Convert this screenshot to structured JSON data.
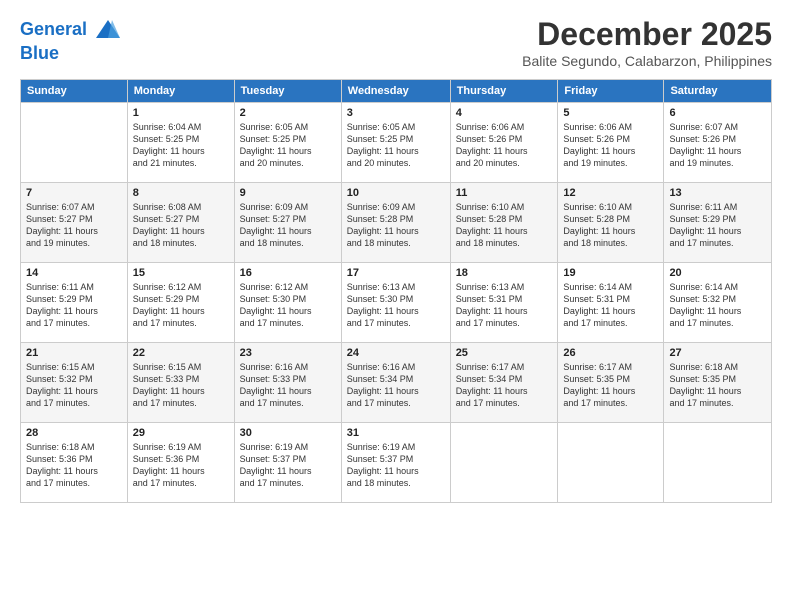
{
  "logo": {
    "line1": "General",
    "line2": "Blue"
  },
  "title": "December 2025",
  "subtitle": "Balite Segundo, Calabarzon, Philippines",
  "header_days": [
    "Sunday",
    "Monday",
    "Tuesday",
    "Wednesday",
    "Thursday",
    "Friday",
    "Saturday"
  ],
  "weeks": [
    [
      {
        "day": "",
        "info": ""
      },
      {
        "day": "1",
        "info": "Sunrise: 6:04 AM\nSunset: 5:25 PM\nDaylight: 11 hours\nand 21 minutes."
      },
      {
        "day": "2",
        "info": "Sunrise: 6:05 AM\nSunset: 5:25 PM\nDaylight: 11 hours\nand 20 minutes."
      },
      {
        "day": "3",
        "info": "Sunrise: 6:05 AM\nSunset: 5:25 PM\nDaylight: 11 hours\nand 20 minutes."
      },
      {
        "day": "4",
        "info": "Sunrise: 6:06 AM\nSunset: 5:26 PM\nDaylight: 11 hours\nand 20 minutes."
      },
      {
        "day": "5",
        "info": "Sunrise: 6:06 AM\nSunset: 5:26 PM\nDaylight: 11 hours\nand 19 minutes."
      },
      {
        "day": "6",
        "info": "Sunrise: 6:07 AM\nSunset: 5:26 PM\nDaylight: 11 hours\nand 19 minutes."
      }
    ],
    [
      {
        "day": "7",
        "info": "Sunrise: 6:07 AM\nSunset: 5:27 PM\nDaylight: 11 hours\nand 19 minutes."
      },
      {
        "day": "8",
        "info": "Sunrise: 6:08 AM\nSunset: 5:27 PM\nDaylight: 11 hours\nand 18 minutes."
      },
      {
        "day": "9",
        "info": "Sunrise: 6:09 AM\nSunset: 5:27 PM\nDaylight: 11 hours\nand 18 minutes."
      },
      {
        "day": "10",
        "info": "Sunrise: 6:09 AM\nSunset: 5:28 PM\nDaylight: 11 hours\nand 18 minutes."
      },
      {
        "day": "11",
        "info": "Sunrise: 6:10 AM\nSunset: 5:28 PM\nDaylight: 11 hours\nand 18 minutes."
      },
      {
        "day": "12",
        "info": "Sunrise: 6:10 AM\nSunset: 5:28 PM\nDaylight: 11 hours\nand 18 minutes."
      },
      {
        "day": "13",
        "info": "Sunrise: 6:11 AM\nSunset: 5:29 PM\nDaylight: 11 hours\nand 17 minutes."
      }
    ],
    [
      {
        "day": "14",
        "info": "Sunrise: 6:11 AM\nSunset: 5:29 PM\nDaylight: 11 hours\nand 17 minutes."
      },
      {
        "day": "15",
        "info": "Sunrise: 6:12 AM\nSunset: 5:29 PM\nDaylight: 11 hours\nand 17 minutes."
      },
      {
        "day": "16",
        "info": "Sunrise: 6:12 AM\nSunset: 5:30 PM\nDaylight: 11 hours\nand 17 minutes."
      },
      {
        "day": "17",
        "info": "Sunrise: 6:13 AM\nSunset: 5:30 PM\nDaylight: 11 hours\nand 17 minutes."
      },
      {
        "day": "18",
        "info": "Sunrise: 6:13 AM\nSunset: 5:31 PM\nDaylight: 11 hours\nand 17 minutes."
      },
      {
        "day": "19",
        "info": "Sunrise: 6:14 AM\nSunset: 5:31 PM\nDaylight: 11 hours\nand 17 minutes."
      },
      {
        "day": "20",
        "info": "Sunrise: 6:14 AM\nSunset: 5:32 PM\nDaylight: 11 hours\nand 17 minutes."
      }
    ],
    [
      {
        "day": "21",
        "info": "Sunrise: 6:15 AM\nSunset: 5:32 PM\nDaylight: 11 hours\nand 17 minutes."
      },
      {
        "day": "22",
        "info": "Sunrise: 6:15 AM\nSunset: 5:33 PM\nDaylight: 11 hours\nand 17 minutes."
      },
      {
        "day": "23",
        "info": "Sunrise: 6:16 AM\nSunset: 5:33 PM\nDaylight: 11 hours\nand 17 minutes."
      },
      {
        "day": "24",
        "info": "Sunrise: 6:16 AM\nSunset: 5:34 PM\nDaylight: 11 hours\nand 17 minutes."
      },
      {
        "day": "25",
        "info": "Sunrise: 6:17 AM\nSunset: 5:34 PM\nDaylight: 11 hours\nand 17 minutes."
      },
      {
        "day": "26",
        "info": "Sunrise: 6:17 AM\nSunset: 5:35 PM\nDaylight: 11 hours\nand 17 minutes."
      },
      {
        "day": "27",
        "info": "Sunrise: 6:18 AM\nSunset: 5:35 PM\nDaylight: 11 hours\nand 17 minutes."
      }
    ],
    [
      {
        "day": "28",
        "info": "Sunrise: 6:18 AM\nSunset: 5:36 PM\nDaylight: 11 hours\nand 17 minutes."
      },
      {
        "day": "29",
        "info": "Sunrise: 6:19 AM\nSunset: 5:36 PM\nDaylight: 11 hours\nand 17 minutes."
      },
      {
        "day": "30",
        "info": "Sunrise: 6:19 AM\nSunset: 5:37 PM\nDaylight: 11 hours\nand 17 minutes."
      },
      {
        "day": "31",
        "info": "Sunrise: 6:19 AM\nSunset: 5:37 PM\nDaylight: 11 hours\nand 18 minutes."
      },
      {
        "day": "",
        "info": ""
      },
      {
        "day": "",
        "info": ""
      },
      {
        "day": "",
        "info": ""
      }
    ]
  ]
}
